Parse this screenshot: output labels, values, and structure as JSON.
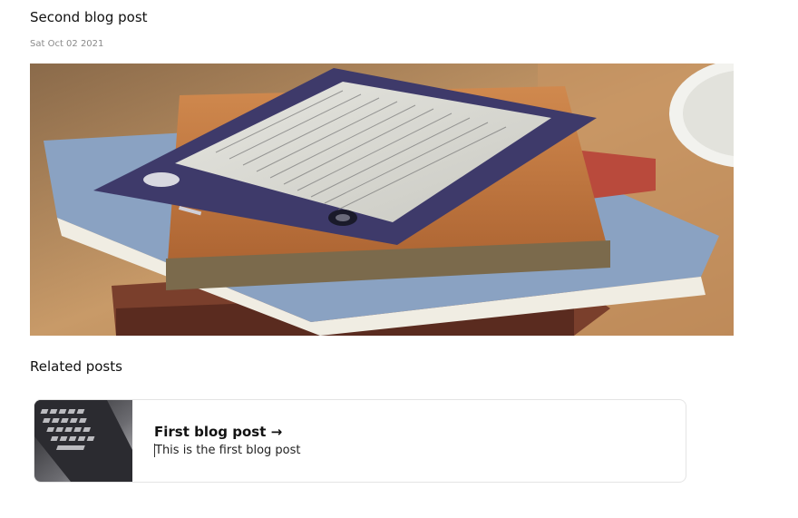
{
  "post": {
    "title": "Second blog post",
    "date": "Sat Oct 02 2021",
    "image_label": "ebook-reader-on-books-image"
  },
  "related": {
    "heading": "Related posts",
    "items": [
      {
        "title": "First blog post →",
        "excerpt": "This is the first blog post",
        "thumb_label": "laptop-keyboard-image"
      }
    ]
  }
}
